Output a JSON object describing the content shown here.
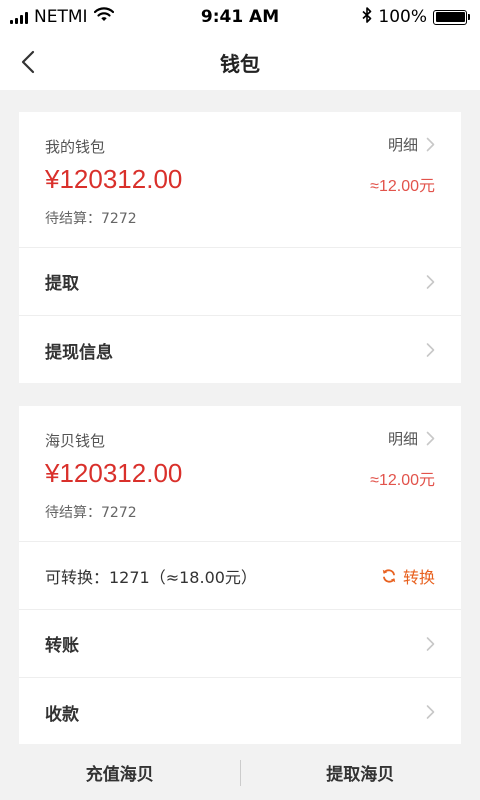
{
  "status_bar": {
    "carrier": "NETMI",
    "time": "9:41 AM",
    "battery": "100%"
  },
  "nav": {
    "title": "钱包"
  },
  "my_wallet": {
    "label": "我的钱包",
    "detail_label": "明细",
    "amount": "¥120312.00",
    "approx": "≈12.00元",
    "pending": "待结算：7272",
    "rows": [
      {
        "label": "提取"
      },
      {
        "label": "提现信息"
      }
    ]
  },
  "haibei_wallet": {
    "label": "海贝钱包",
    "detail_label": "明细",
    "amount": "¥120312.00",
    "approx": "≈12.00元",
    "pending": "待结算：7272",
    "convertible": "可转换：1271（≈18.00元）",
    "convert_label": "转换",
    "rows": [
      {
        "label": "转账"
      },
      {
        "label": "收款"
      }
    ]
  },
  "bottom_bar": {
    "recharge_label": "充值海贝",
    "withdraw_label": "提取海贝"
  },
  "colors": {
    "amount_red": "#d9302b",
    "accent_orange": "#e8611f",
    "background": "#f2f2f2"
  }
}
